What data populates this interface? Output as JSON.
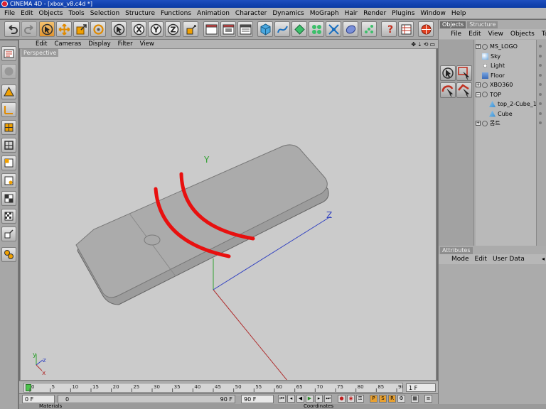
{
  "window": {
    "title": "CINEMA 4D - [xbox_v8.c4d *]"
  },
  "menubar": [
    "File",
    "Edit",
    "Objects",
    "Tools",
    "Selection",
    "Structure",
    "Functions",
    "Animation",
    "Character",
    "Dynamics",
    "MoGraph",
    "Hair",
    "Render",
    "Plugins",
    "Window",
    "Help"
  ],
  "toolbar": {
    "axis_x": "X",
    "axis_y": "Y",
    "axis_z": "Z",
    "icons": [
      "undo-icon",
      "redo-icon",
      "live-select-icon",
      "move-icon",
      "scale-icon",
      "rotate-icon",
      "select-icon",
      "x-axis-lock-icon",
      "y-axis-lock-icon",
      "z-axis-lock-icon",
      "coordinate-system-icon",
      "render-view-icon",
      "render-picture-viewer-icon",
      "render-settings-icon",
      "cube-primitive-icon",
      "spline-icon",
      "nurbs-icon",
      "array-icon",
      "deformer-icon",
      "scene-icon",
      "mograph-icon",
      "help-icon",
      "browser-icon",
      "web-icon"
    ]
  },
  "left_tools": [
    "model-mode-icon",
    "texture-mode-icon",
    "object-axis-icon",
    "world-axis-icon",
    "points-mode-icon",
    "edges-mode-icon",
    "polygons-mode-icon",
    "uvw-points-icon",
    "uvw-polygons-icon",
    "snap-icon",
    "tweak-mode-icon",
    "sculpt-icon"
  ],
  "viewport": {
    "menu": [
      "Edit",
      "Cameras",
      "Display",
      "Filter",
      "View"
    ],
    "label": "Perspective",
    "axis_labels": {
      "y": "Y",
      "z": "Z"
    },
    "mini_axis": {
      "y": "y",
      "z": "z",
      "x": "x"
    },
    "colors": {
      "background": "#cbcbcb",
      "object": "#a8a8a8",
      "stroke": "#e8100f",
      "axis_x": "#b03030",
      "axis_y": "#30a030",
      "axis_z": "#3040c0"
    }
  },
  "timeline": {
    "ticks": [
      "0",
      "5",
      "10",
      "15",
      "20",
      "25",
      "30",
      "35",
      "40",
      "45",
      "50",
      "55",
      "60",
      "65",
      "70",
      "75",
      "80",
      "85",
      "90"
    ],
    "current_frame": "1 F"
  },
  "transport": {
    "start": "0 F",
    "end_slider": "90 F",
    "end": "90 F",
    "start_marker": "0"
  },
  "object_manager": {
    "tabs": [
      "Objects",
      "Structure"
    ],
    "menu": [
      "File",
      "Edit",
      "View",
      "Objects",
      "Tags"
    ],
    "tree": [
      {
        "name": "MS_LOGO",
        "level": 0,
        "expander": "+",
        "icon": "null-object-icon"
      },
      {
        "name": "Sky",
        "level": 0,
        "expander": "",
        "icon": "sky-icon"
      },
      {
        "name": "Light",
        "level": 0,
        "expander": "",
        "icon": "light-icon"
      },
      {
        "name": "Floor",
        "level": 0,
        "expander": "",
        "icon": "floor-icon"
      },
      {
        "name": "XBO360",
        "level": 0,
        "expander": "+",
        "icon": "null-object-icon"
      },
      {
        "name": "TOP",
        "level": 0,
        "expander": "−",
        "icon": "null-object-icon"
      },
      {
        "name": "top_2-Cube_1",
        "level": 1,
        "expander": "",
        "icon": "polygon-object-icon"
      },
      {
        "name": "Cube",
        "level": 1,
        "expander": "",
        "icon": "polygon-object-icon"
      },
      {
        "name": "몸트",
        "level": 0,
        "expander": "+",
        "icon": "null-object-icon"
      }
    ]
  },
  "attributes": {
    "tab": "Attributes",
    "menu": [
      "Mode",
      "Edit",
      "User Data"
    ]
  },
  "bottom_tabs": {
    "materials": "Materials",
    "coordinates": "Coordinates"
  }
}
